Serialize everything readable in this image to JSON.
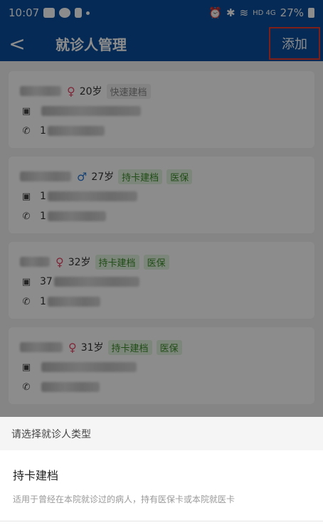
{
  "status": {
    "time": "10:07",
    "signal_text": "HD 4G",
    "battery": "27%"
  },
  "nav": {
    "title": "就诊人管理",
    "back_label": "<",
    "add_label": "添加"
  },
  "patients": [
    {
      "gender_symbol": "♀",
      "age": "20岁",
      "tags": [
        "快速建档"
      ],
      "id_prefix": "",
      "phone_prefix": "1"
    },
    {
      "gender_symbol": "♂",
      "age": "27岁",
      "tags": [
        "持卡建档",
        "医保"
      ],
      "id_prefix": "1",
      "phone_prefix": "1"
    },
    {
      "gender_symbol": "♀",
      "age": "32岁",
      "tags": [
        "持卡建档",
        "医保"
      ],
      "id_prefix": "37",
      "phone_prefix": "1"
    },
    {
      "gender_symbol": "♀",
      "age": "31岁",
      "tags": [
        "持卡建档",
        "医保"
      ],
      "id_prefix": "",
      "phone_prefix": ""
    }
  ],
  "icons": {
    "id_card": "id-card-icon",
    "phone": "phone-icon"
  },
  "sheet": {
    "header": "请选择就诊人类型",
    "option_title": "持卡建档",
    "option_desc": "适用于曾经在本院就诊过的病人，持有医保卡或本院就医卡"
  },
  "colors": {
    "primary": "#0a4e9b",
    "highlight": "#e8392c",
    "tag_green": "#3b8a2a",
    "female": "#e84a6b",
    "male": "#2a7ad6"
  }
}
